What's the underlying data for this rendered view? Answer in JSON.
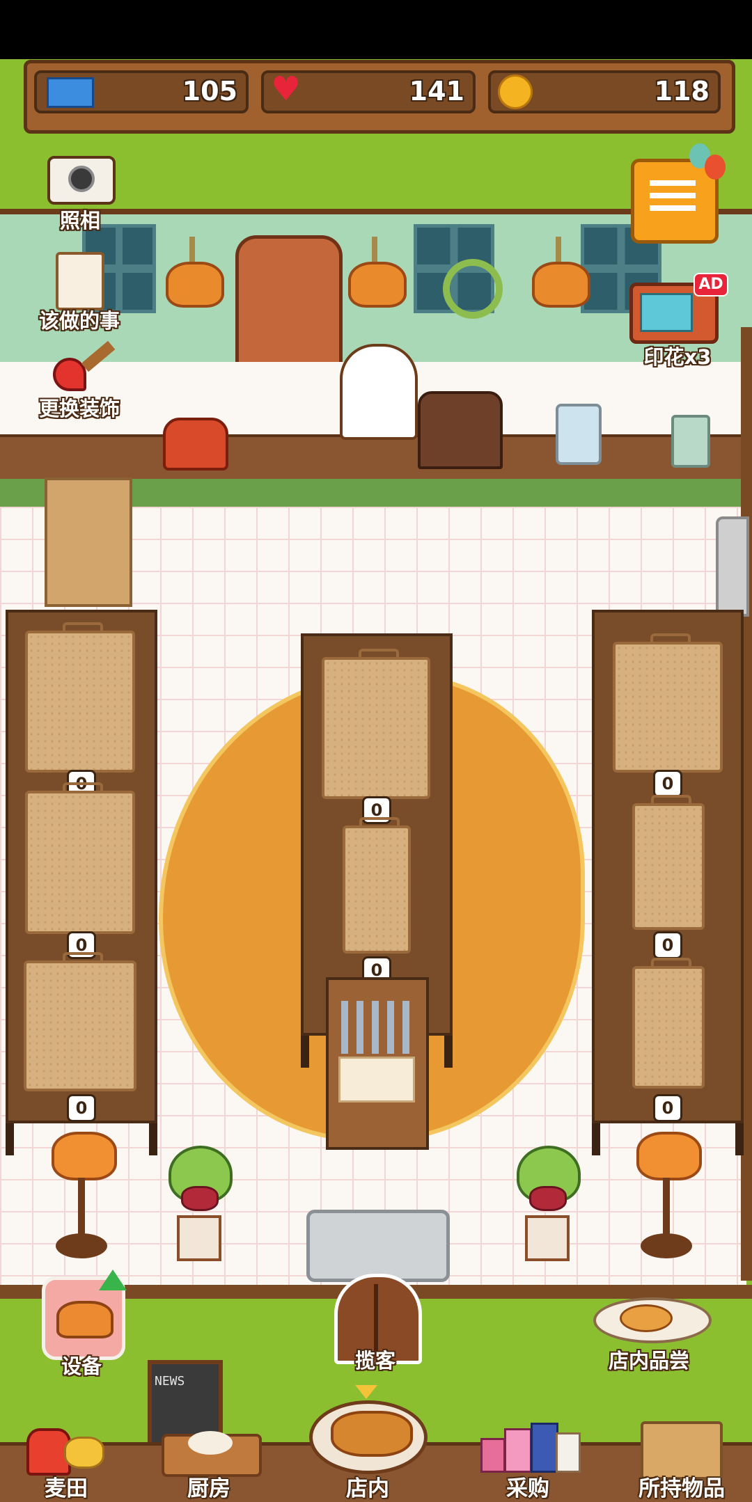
{
  "resources": {
    "tickets": "105",
    "hearts": "141",
    "coins": "118"
  },
  "left_menu": {
    "camera_label": "照相",
    "todo_label": "该做的事",
    "decor_label": "更换装饰"
  },
  "right_menu": {
    "ad_badge": "AD",
    "stamp_label": "印花x3"
  },
  "shelves": {
    "left_counts": [
      "0",
      "0",
      "0"
    ],
    "middle_counts": [
      "0",
      "0"
    ],
    "right_counts": [
      "0",
      "0",
      "0"
    ]
  },
  "floor_actions": {
    "equipment_label": "设备",
    "solicit_label": "揽客",
    "tasting_label": "店内品尝"
  },
  "chalkboard_text": "NEWS",
  "bottom_nav": {
    "items": [
      {
        "label": "麦田",
        "icon": "wheat-field-icon"
      },
      {
        "label": "厨房",
        "icon": "kitchen-icon"
      },
      {
        "label": "店内",
        "icon": "shop-icon"
      },
      {
        "label": "采购",
        "icon": "purchase-icon"
      },
      {
        "label": "所持物品",
        "icon": "inventory-icon"
      }
    ],
    "active": "店内"
  },
  "colors": {
    "grass": "#8cbf2f",
    "wood": "#7a4a25",
    "wall": "#a9d8b6",
    "floor": "#fbf7f3"
  }
}
